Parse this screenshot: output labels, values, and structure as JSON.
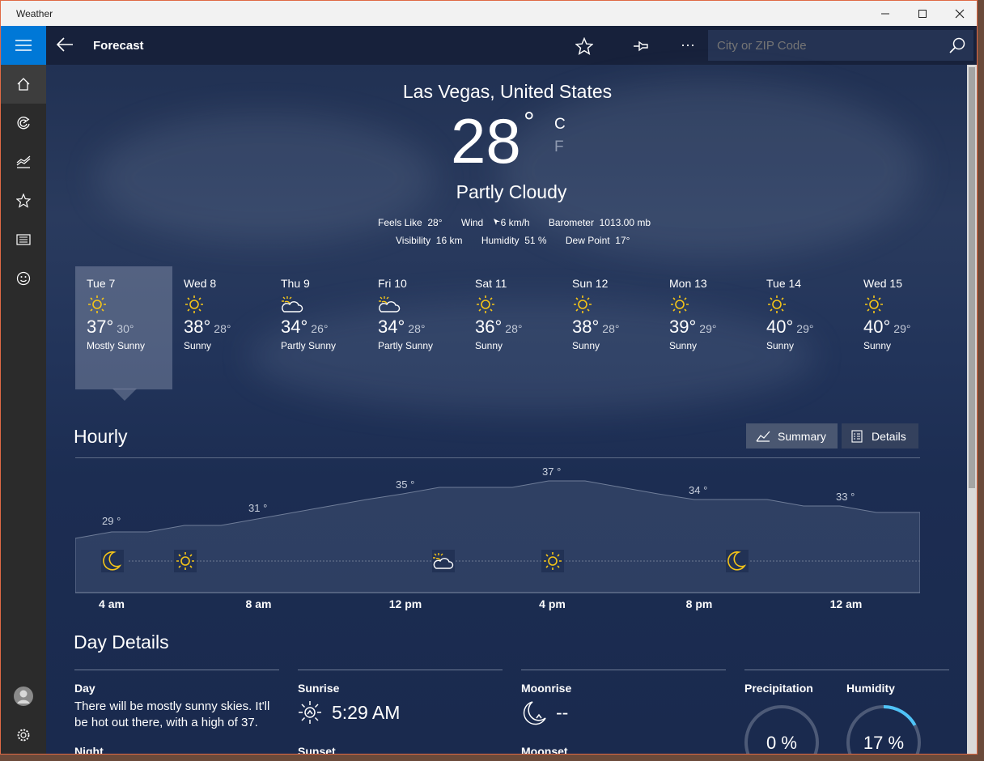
{
  "window": {
    "title": "Weather"
  },
  "topbar": {
    "title": "Forecast",
    "search_placeholder": "City or ZIP Code"
  },
  "current": {
    "location": "Las Vegas, United States",
    "temp": "28",
    "deg": "°",
    "unit_c": "C",
    "unit_f": "F",
    "condition": "Partly Cloudy",
    "feels_like_label": "Feels Like",
    "feels_like": "28°",
    "wind_label": "Wind",
    "wind": "6 km/h",
    "barometer_label": "Barometer",
    "barometer": "1013.00 mb",
    "visibility_label": "Visibility",
    "visibility": "16 km",
    "humidity_label": "Humidity",
    "humidity": "51 %",
    "dewpoint_label": "Dew Point",
    "dewpoint": "17°"
  },
  "daily": [
    {
      "day": "Tue 7",
      "hi": "37°",
      "lo": "30°",
      "cond": "Mostly Sunny",
      "icon": "sun-icon"
    },
    {
      "day": "Wed 8",
      "hi": "38°",
      "lo": "28°",
      "cond": "Sunny",
      "icon": "sun-icon"
    },
    {
      "day": "Thu 9",
      "hi": "34°",
      "lo": "26°",
      "cond": "Partly Sunny",
      "icon": "partly-sunny-icon"
    },
    {
      "day": "Fri 10",
      "hi": "34°",
      "lo": "28°",
      "cond": "Partly Sunny",
      "icon": "partly-sunny-icon"
    },
    {
      "day": "Sat 11",
      "hi": "36°",
      "lo": "28°",
      "cond": "Sunny",
      "icon": "sun-icon"
    },
    {
      "day": "Sun 12",
      "hi": "38°",
      "lo": "28°",
      "cond": "Sunny",
      "icon": "sun-icon"
    },
    {
      "day": "Mon 13",
      "hi": "39°",
      "lo": "29°",
      "cond": "Sunny",
      "icon": "sun-icon"
    },
    {
      "day": "Tue 14",
      "hi": "40°",
      "lo": "29°",
      "cond": "Sunny",
      "icon": "sun-icon"
    },
    {
      "day": "Wed 15",
      "hi": "40°",
      "lo": "29°",
      "cond": "Sunny",
      "icon": "sun-icon"
    }
  ],
  "hourly": {
    "title": "Hourly",
    "summary_label": "Summary",
    "details_label": "Details",
    "temp_labels": [
      "29 °",
      "31 °",
      "35 °",
      "37 °",
      "34 °",
      "33 °"
    ],
    "time_labels": [
      "4 am",
      "8 am",
      "12 pm",
      "4 pm",
      "8 pm",
      "12 am"
    ],
    "icons": [
      "moon-icon",
      "sun-icon",
      "partly-sunny-icon",
      "sun-icon",
      "moon-icon"
    ]
  },
  "day_details": {
    "title": "Day Details",
    "day_label": "Day",
    "day_text": "There will be mostly sunny skies. It'll be hot out there, with a high of 37.",
    "night_label": "Night",
    "sunrise_label": "Sunrise",
    "sunrise": "5:29 AM",
    "sunset_label": "Sunset",
    "moonrise_label": "Moonrise",
    "moonrise": "--",
    "moonset_label": "Moonset",
    "precip_label": "Precipitation",
    "precip": "0 %",
    "precip_value": 0,
    "humidity_label": "Humidity",
    "humidity": "17 %",
    "humidity_value": 17
  },
  "colors": {
    "accent": "#0078d7",
    "sun": "#f5c518",
    "ring": "#4fc3f7"
  }
}
